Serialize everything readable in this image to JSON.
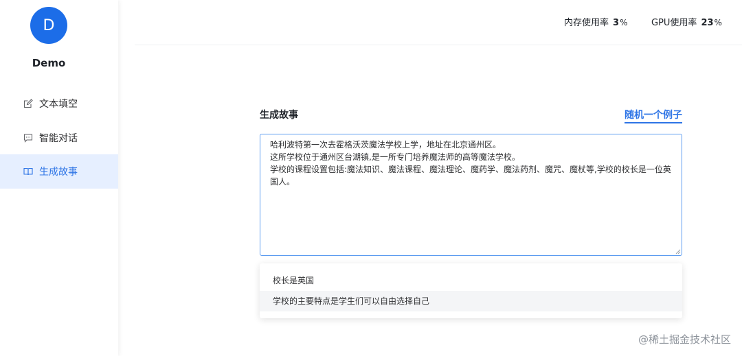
{
  "sidebar": {
    "avatar_letter": "D",
    "username": "Demo",
    "items": [
      {
        "label": "文本填空",
        "icon": "edit-icon",
        "active": false
      },
      {
        "label": "智能对话",
        "icon": "chat-icon",
        "active": false
      },
      {
        "label": "生成故事",
        "icon": "book-icon",
        "active": true
      }
    ]
  },
  "topbar": {
    "memory": {
      "label": "内存使用率",
      "value": "3",
      "unit": "%"
    },
    "gpu": {
      "label": "GPU使用率",
      "value": "23",
      "unit": "%"
    }
  },
  "main": {
    "section_title": "生成故事",
    "random_link": "随机一个例子",
    "textarea_value": "哈利波特第一次去霍格沃茨魔法学校上学，地址在北京通州区。\n这所学校位于通州区台湖镇,是一所专门培养魔法师的高等魔法学校。\n学校的课程设置包括:魔法知识、魔法课程、魔法理论、魔药学、魔法药剂、魔咒、魔杖等,学校的校长是一位英国人。",
    "suggestions": [
      "校长是英国",
      "学校的主要特点是学生们可以自由选择自己"
    ]
  },
  "watermark": "@稀土掘金技术社区",
  "colors": {
    "accent": "#2d74e6",
    "active_bg": "#e6efff",
    "avatar_bg": "#1c6de8"
  }
}
